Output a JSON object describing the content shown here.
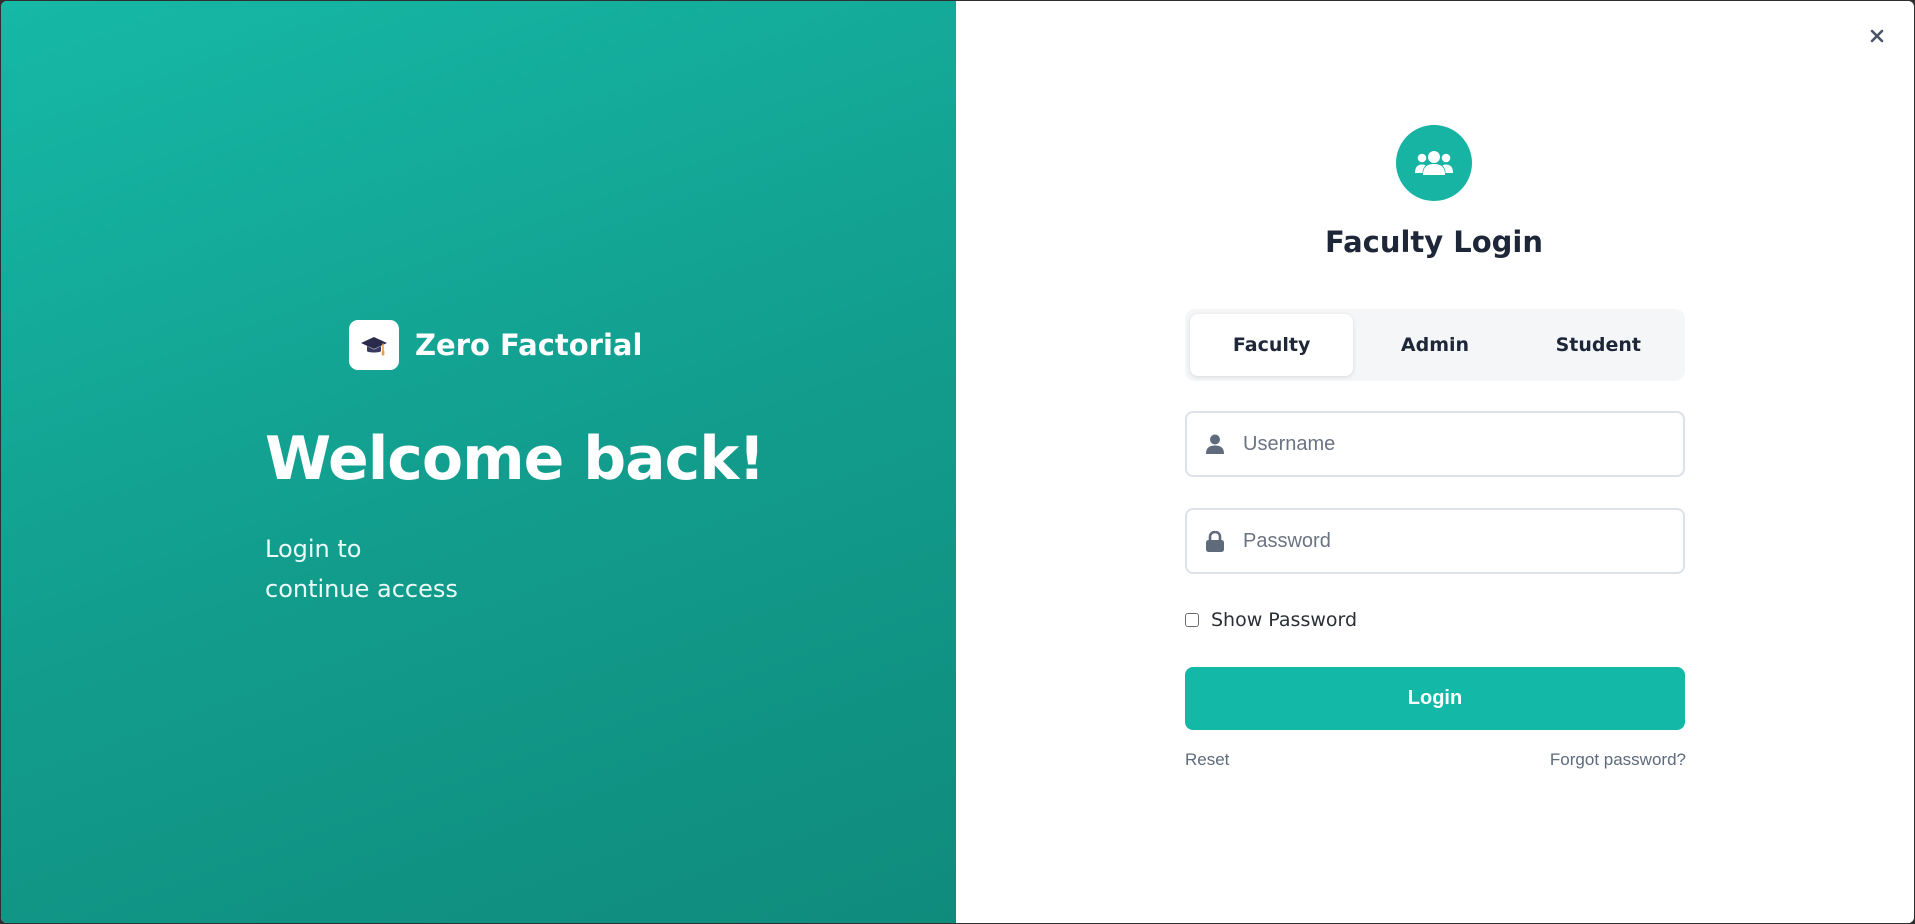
{
  "brand": {
    "logo_icon": "graduation-cap-icon",
    "name": "Zero Factorial"
  },
  "hero": {
    "heading": "Welcome back!",
    "subtitle_line1": "Login to",
    "subtitle_line2": "continue access"
  },
  "login": {
    "header_icon": "users-group-icon",
    "title": "Faculty Login",
    "tabs": [
      {
        "label": "Faculty",
        "active": true
      },
      {
        "label": "Admin",
        "active": false
      },
      {
        "label": "Student",
        "active": false
      }
    ],
    "username": {
      "placeholder": "Username",
      "value": "",
      "icon": "user-icon"
    },
    "password": {
      "placeholder": "Password",
      "value": "",
      "icon": "lock-icon"
    },
    "show_password_label": "Show Password",
    "show_password_checked": false,
    "submit_label": "Login",
    "reset_label": "Reset",
    "forgot_label": "Forgot password?"
  },
  "close_icon": "close-icon",
  "colors": {
    "accent": "#14b8a6",
    "gradient_start": "#16b8a6",
    "gradient_end": "#0f8b7c",
    "title_text": "#1e2738",
    "muted_link": "#5d6b7c"
  }
}
